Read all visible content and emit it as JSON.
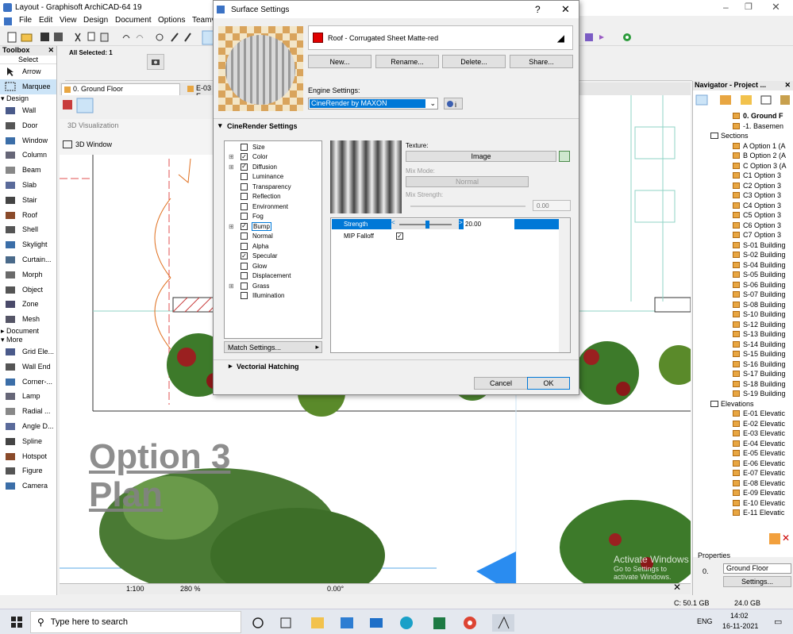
{
  "window": {
    "title": "Layout - Graphisoft ArchiCAD-64 19"
  },
  "menu": [
    "File",
    "Edit",
    "View",
    "Design",
    "Document",
    "Options",
    "Teamv"
  ],
  "infobox": {
    "all_selected": "All Selected: 1"
  },
  "toolbox": {
    "title": "Toolbox",
    "select_label": "Select",
    "select_items": [
      "Arrow",
      "Marquee"
    ],
    "design_label": "Design",
    "design_items": [
      "Wall",
      "Door",
      "Window",
      "Column",
      "Beam",
      "Slab",
      "Stair",
      "Roof",
      "Shell",
      "Skylight",
      "Curtain...",
      "Morph",
      "Object",
      "Zone",
      "Mesh"
    ],
    "document_label": "Document",
    "more_label": "More",
    "more_items": [
      "Grid Ele...",
      "Wall End",
      "Corner-...",
      "Lamp",
      "Radial ...",
      "Angle D...",
      "Spline",
      "Hotspot",
      "Figure",
      "Camera"
    ]
  },
  "tabs": {
    "floor": "0. Ground Floor",
    "e03": "E-03 E"
  },
  "canvas": {
    "view_label": "3D Visualization",
    "window_btn": "3D Window",
    "plan_text_1": "Option 3",
    "plan_text_2": "Plan",
    "watermark_1": "Activate Windows",
    "watermark_2": "Go to Settings to activate Windows."
  },
  "status": {
    "scale": "1:100",
    "zoom": "280 %",
    "angle": "0.00°",
    "disk": "C: 50.1 GB",
    "ram": "24.0 GB"
  },
  "navigator": {
    "title": "Navigator - Project ...",
    "floors": [
      "0. Ground F",
      "-1. Basemen"
    ],
    "sections_label": "Sections",
    "sections": [
      "A Option 1 (A",
      "B Option 2 (A",
      "C Option 3 (A",
      "C1 Option 3",
      "C2 Option 3",
      "C3 Option 3",
      "C4 Option 3",
      "C5 Option 3",
      "C6 Option 3",
      "C7 Option 3",
      "S-01 Building",
      "S-02 Building",
      "S-04 Building",
      "S-05 Building",
      "S-06 Building",
      "S-07 Building",
      "S-08 Building",
      "S-10 Building",
      "S-12 Building",
      "S-13 Building",
      "S-14 Building",
      "S-15 Building",
      "S-16 Building",
      "S-17 Building",
      "S-18 Building",
      "S-19 Building"
    ],
    "elevations_label": "Elevations",
    "elevations": [
      "E-01 Elevatic",
      "E-02 Elevatic",
      "E-03 Elevatic",
      "E-04 Elevatic",
      "E-05 Elevatic",
      "E-06 Elevatic",
      "E-07 Elevatic",
      "E-08 Elevatic",
      "E-09 Elevatic",
      "E-10 Elevatic",
      "E-11 Elevatic"
    ],
    "properties_label": "Properties",
    "prop_num": "0.",
    "prop_value": "Ground Floor",
    "settings_btn": "Settings..."
  },
  "dialog": {
    "title": "Surface Settings",
    "help": "?",
    "surface_name": "Roof - Corrugated Sheet Matte-red",
    "surface_color": "#e00000",
    "buttons": {
      "new": "New...",
      "rename": "Rename...",
      "delete": "Delete...",
      "share": "Share..."
    },
    "engine_label": "Engine Settings:",
    "engine_value": "CineRender by MAXON",
    "cine_section": "CineRender Settings",
    "channels": [
      {
        "label": "Size",
        "checked": false,
        "expand": false
      },
      {
        "label": "Color",
        "checked": true,
        "expand": true
      },
      {
        "label": "Diffusion",
        "checked": true,
        "expand": true
      },
      {
        "label": "Luminance",
        "checked": false,
        "expand": false
      },
      {
        "label": "Transparency",
        "checked": false,
        "expand": false
      },
      {
        "label": "Reflection",
        "checked": false,
        "expand": false
      },
      {
        "label": "Environment",
        "checked": false,
        "expand": false
      },
      {
        "label": "Fog",
        "checked": false,
        "expand": false
      },
      {
        "label": "Bump",
        "checked": true,
        "expand": true
      },
      {
        "label": "Normal",
        "checked": false,
        "expand": false
      },
      {
        "label": "Alpha",
        "checked": false,
        "expand": false
      },
      {
        "label": "Specular",
        "checked": true,
        "expand": false
      },
      {
        "label": "Glow",
        "checked": false,
        "expand": false
      },
      {
        "label": "Displacement",
        "checked": false,
        "expand": false
      },
      {
        "label": "Grass",
        "checked": false,
        "expand": true
      },
      {
        "label": "Illumination",
        "checked": false,
        "expand": false
      }
    ],
    "texture_label": "Texture:",
    "texture_btn": "Image",
    "mix_mode_label": "Mix Mode:",
    "mix_mode_value": "Normal",
    "mix_strength_label": "Mix Strength:",
    "mix_strength_value": "0.00",
    "strength_label": "Strength",
    "strength_value": "20.00",
    "strength_fraction": 0.2,
    "mip_label": "MIP Falloff",
    "mip_checked": true,
    "match_btn": "Match Settings...",
    "vectorial_section": "Vectorial Hatching",
    "cancel": "Cancel",
    "ok": "OK"
  },
  "taskbar": {
    "search_placeholder": "Type here to search",
    "lang": "ENG",
    "time": "14:02",
    "date": "16-11-2021"
  }
}
